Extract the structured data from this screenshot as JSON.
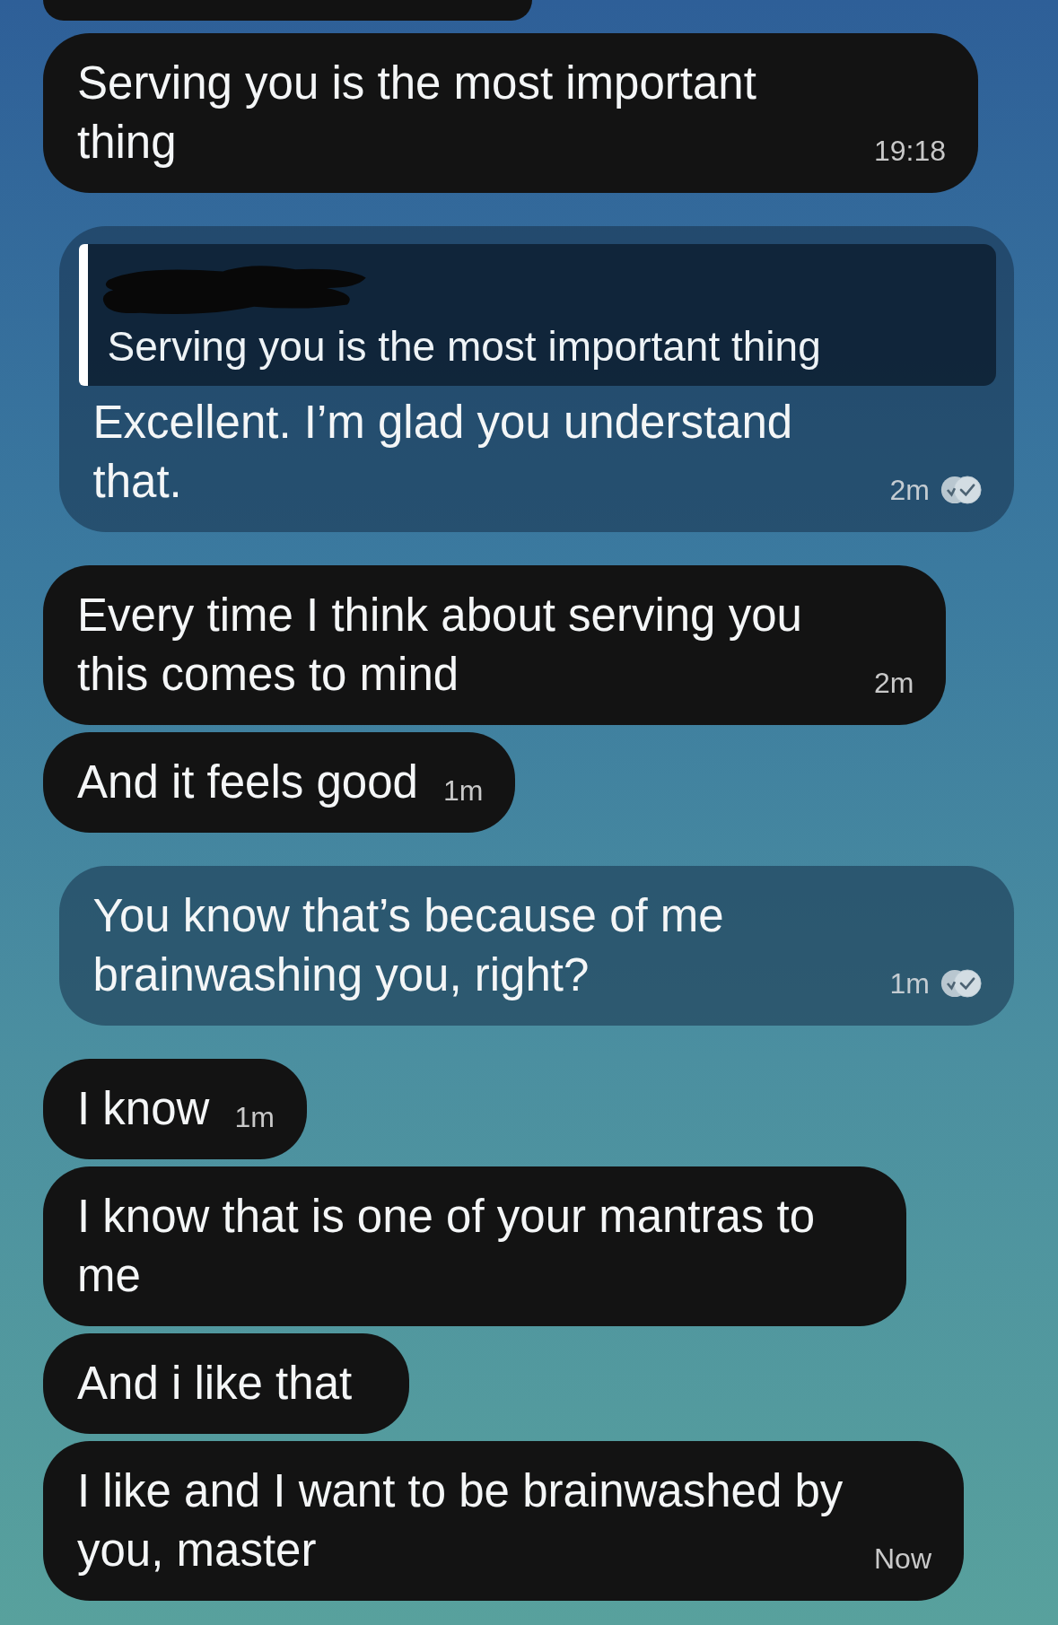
{
  "messages": [
    {
      "kind": "clipped"
    },
    {
      "kind": "incoming",
      "text": "Serving you is the most important thing",
      "time": "19:18"
    },
    {
      "kind": "outgoing",
      "reply_to": {
        "text": "Serving you is the most important thing",
        "sender_redacted": true
      },
      "text": "Excellent. I’m glad you understand that.",
      "time": "2m",
      "read": true
    },
    {
      "kind": "incoming",
      "text": "Every time I think about serving you this comes to mind",
      "time": "2m"
    },
    {
      "kind": "incoming",
      "text": "And it feels good",
      "time": "1m"
    },
    {
      "kind": "outgoing",
      "text": "You know that’s because of me brainwashing you, right?",
      "time": "1m",
      "read": true
    },
    {
      "kind": "incoming",
      "text": "I know",
      "time": "1m"
    },
    {
      "kind": "incoming",
      "text": "I know that is one of your mantras to me"
    },
    {
      "kind": "incoming",
      "text": "And i like that"
    },
    {
      "kind": "incoming",
      "text": "I like and I want to be brainwashed by you, master",
      "time": "Now"
    }
  ]
}
